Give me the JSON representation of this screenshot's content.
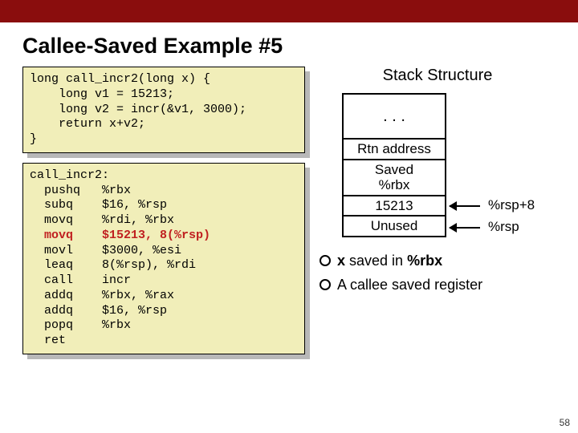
{
  "title": "Callee-Saved Example #5",
  "code_c": "long call_incr2(long x) {\n    long v1 = 15213;\n    long v2 = incr(&v1, 3000);\n    return x+v2;\n}",
  "code_asm_pre": "call_incr2:\n  pushq   %rbx\n  subq    $16, %rsp\n  movq    %rdi, %rbx",
  "code_asm_hl": "  movq    $15213, 8(%rsp)",
  "code_asm_post": "  movl    $3000, %esi\n  leaq    8(%rsp), %rdi\n  call    incr\n  addq    %rbx, %rax\n  addq    $16, %rsp\n  popq    %rbx\n  ret",
  "stack": {
    "title": "Stack Structure",
    "dots": ". . .",
    "rtn": "Rtn address",
    "saved": "Saved\n%rbx",
    "v1": "15213",
    "unused": "Unused",
    "label_rsp8": "%rsp+8",
    "label_rsp": "%rsp"
  },
  "bullets": {
    "b1_pre": "x",
    "b1_mid": " saved in ",
    "b1_post": "%rbx",
    "b2": "A callee saved register"
  },
  "page_num": "58"
}
